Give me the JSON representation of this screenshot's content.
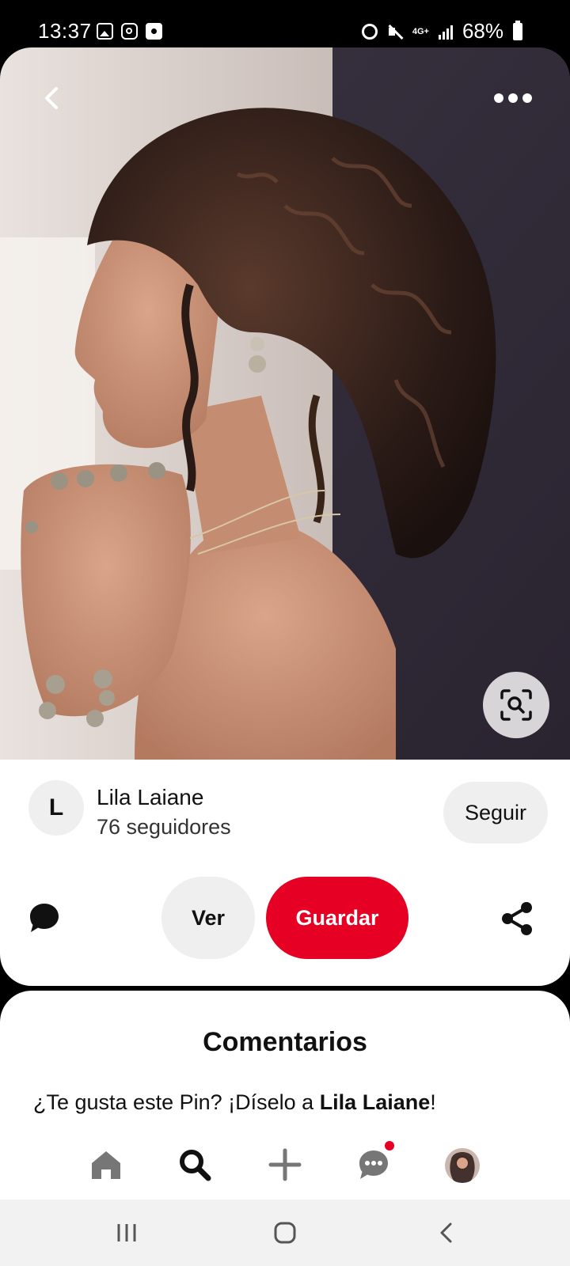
{
  "status_bar": {
    "time": "13:37",
    "network": "4G+",
    "battery": "68%"
  },
  "pin": {
    "image_alt": "pin-photo",
    "actions": {
      "back_icon": "chevron-left-icon",
      "more_icon": "more-dots-icon",
      "visual_search_icon": "lens-search-icon"
    }
  },
  "creator": {
    "initial": "L",
    "name": "Lila Laiane",
    "followers": "76 seguidores",
    "follow_label": "Seguir"
  },
  "action_bar": {
    "view_label": "Ver",
    "save_label": "Guardar",
    "comment_icon": "comment-icon",
    "share_icon": "share-icon"
  },
  "comments": {
    "title": "Comentarios",
    "prompt_prefix": "¿Te gusta este Pin? ¡Díselo a ",
    "prompt_name": "Lila Laiane",
    "prompt_suffix": "!"
  },
  "tab_bar": {
    "items": [
      "home-icon",
      "search-icon",
      "create-icon",
      "messages-icon",
      "profile-avatar"
    ],
    "messages_has_notification": true
  },
  "colors": {
    "brand_red": "#e60023",
    "button_gray": "#efefef"
  }
}
